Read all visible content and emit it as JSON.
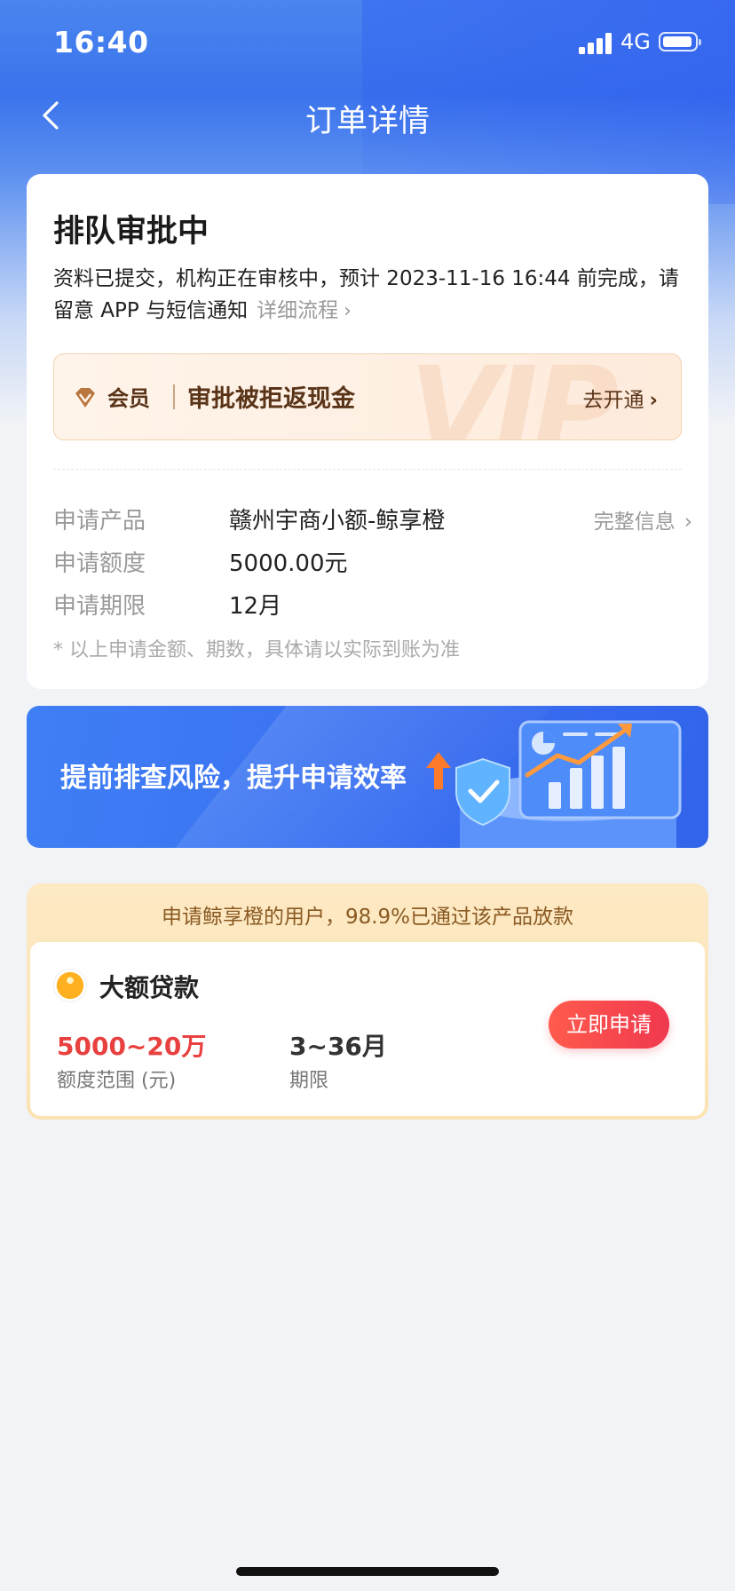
{
  "status_bar": {
    "time": "16:40",
    "network": "4G"
  },
  "nav": {
    "title": "订单详情"
  },
  "status_card": {
    "title": "排队审批中",
    "description": "资料已提交，机构正在审核中，预计 2023-11-16 16:44 前完成，请留意 APP 与短信通知",
    "flow_link": "详细流程",
    "vip": {
      "tag": "会员",
      "title": "审批被拒返现金",
      "action": "去开通",
      "watermark": "VIP"
    },
    "info": [
      {
        "label": "申请产品",
        "value": "赣州宇商小额-鲸享橙",
        "link": "完整信息"
      },
      {
        "label": "申请额度",
        "value": "5000.00元"
      },
      {
        "label": "申请期限",
        "value": "12月"
      }
    ],
    "note": "* 以上申请金额、期数，具体请以实际到账为准"
  },
  "promo": {
    "text": "提前排查风险，提升申请效率"
  },
  "loan_card": {
    "header": "申请鲸享橙的用户，98.9%已通过该产品放款",
    "title": "大额贷款",
    "amount": "5000~20万",
    "amount_label": "额度范围 (元)",
    "term": "3~36月",
    "term_label": "期限",
    "button": "立即申请"
  },
  "colors": {
    "primary_blue": "#3a73ec",
    "accent_red": "#e8413f",
    "vip_brown": "#5a3418",
    "gold_bg": "#fde9c4"
  }
}
